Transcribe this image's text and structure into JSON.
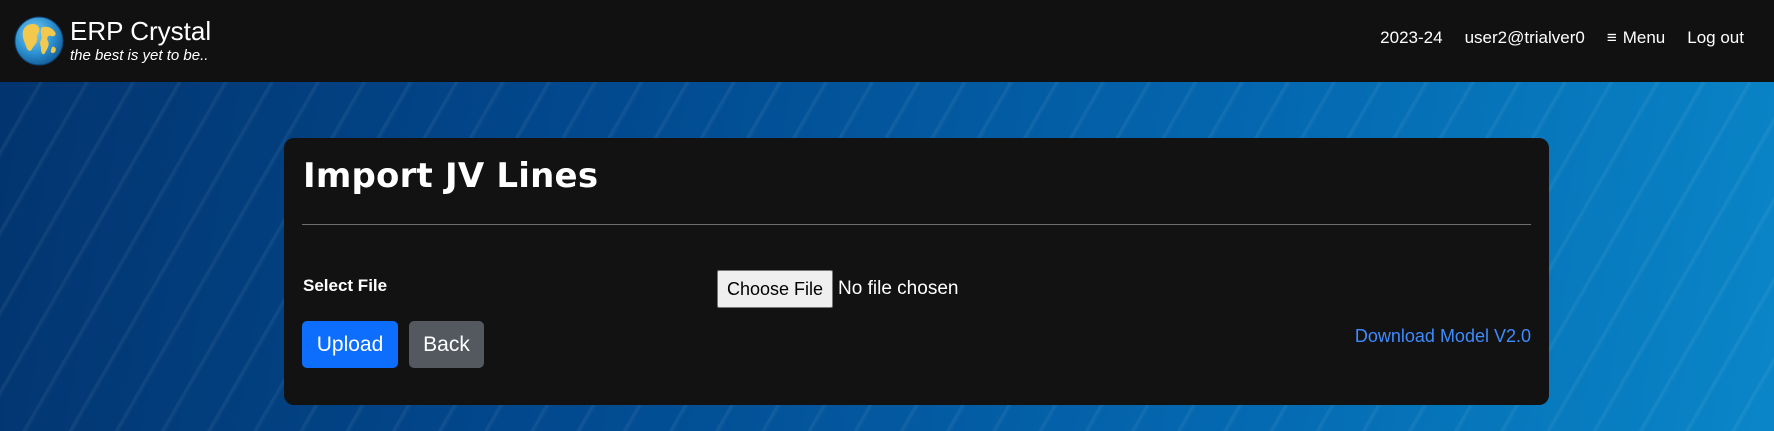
{
  "header": {
    "brand_name": "ERP Crystal",
    "brand_tagline": "the best is yet to be..",
    "fiscal_year": "2023-24",
    "user": "user2@trialver0",
    "menu_icon": "≡",
    "menu_label": "Menu",
    "logout_label": "Log out"
  },
  "form": {
    "title": "Import JV Lines",
    "select_file_label": "Select File",
    "choose_file_label": "Choose File",
    "file_status": "No file chosen",
    "upload_label": "Upload",
    "back_label": "Back",
    "download_label": "Download Model V2.0"
  },
  "colors": {
    "topbar": "#111111",
    "card": "#121212",
    "primary": "#0d6efd",
    "secondary": "#545960",
    "link": "#3d8bfd"
  }
}
